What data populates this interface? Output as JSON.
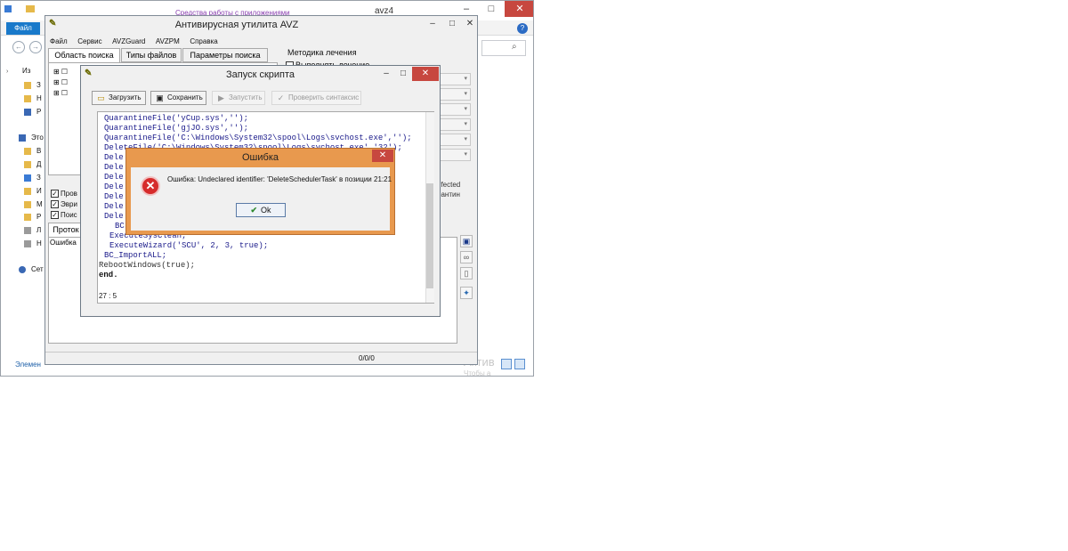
{
  "explorer": {
    "title": "avz4",
    "tools_caption": "Средства работы с приложениями",
    "file_tab": "Файл",
    "controls": {
      "minimize": "–",
      "maximize": "□",
      "close": "✕"
    },
    "help": "?",
    "tree_items": [
      "Из",
      "З",
      "Н",
      "Р",
      "Это",
      "В",
      "Д",
      "З",
      "И",
      "М",
      "Р",
      "Л",
      "Н",
      "Сет"
    ],
    "status_elements": "Элемен",
    "activation": "Актив",
    "activation_sub": "Чтобы а"
  },
  "avz": {
    "title": "Антивирусная утилита AVZ",
    "menu": [
      "Файл",
      "Сервис",
      "AVZGuard",
      "AVZPM",
      "Справка"
    ],
    "tabs": [
      "Область поиска",
      "Типы файлов",
      "Параметры поиска"
    ],
    "method_label": "Методика лечения",
    "method_check": "Выполнять лечение",
    "side_texts": [
      "nfected",
      "рантин"
    ],
    "checkboxes": [
      "Пров",
      "Эври",
      "Поис"
    ],
    "protocol_tab": "Проток",
    "log_text": "Ошибка",
    "status_counter": "0/0/0"
  },
  "script": {
    "title": "Запуск скрипта",
    "buttons": {
      "load": "Загрузить",
      "save": "Сохранить",
      "run": "Запустить",
      "check": "Проверить синтаксис"
    },
    "code": [
      "QuarantineFile('yCup.sys','');",
      "QuarantineFile('gjJO.sys','');",
      "QuarantineFile('C:\\Windows\\System32\\spool\\Logs\\svchost.exe','');",
      "DeleteFile('C:\\Windows\\System32\\spool\\Logs\\svchost.exe','32');",
      "Dele",
      "Dele",
      "Dele",
      "Dele",
      "Dele",
      "Dele",
      "Dele",
      "BC",
      "ExecuteSysClean;",
      "ExecuteWizard('SCU', 2, 3, true);",
      "BC_ImportALL;",
      "RebootWindows(true);",
      "end."
    ],
    "cursor_pos": "27 : 5"
  },
  "error": {
    "title": "Ошибка",
    "message": "Ошибка: Undeclared identifier: 'DeleteSchedulerTask' в позиции 21:21",
    "ok_label": "Ok",
    "icon": "error-x-icon"
  }
}
